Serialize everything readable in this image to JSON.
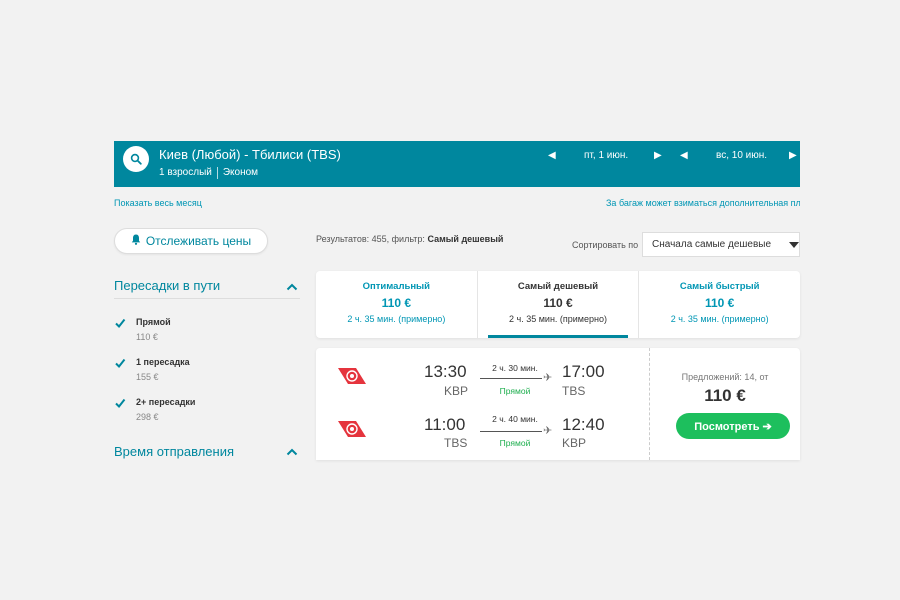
{
  "search": {
    "route": "Киев (Любой) - Тбилиси (TBS)",
    "passengers": "1 взрослый",
    "cabin": "Эконом",
    "date_depart": "пт, 1 июн.",
    "date_return": "вс, 10 июн."
  },
  "links": {
    "show_month": "Показать весь месяц",
    "baggage_note": "За багаж может взиматься дополнительная пла"
  },
  "sidebar": {
    "track_prices": "Отслеживать цены",
    "stops_title": "Пересадки в пути",
    "stops": [
      {
        "label": "Прямой",
        "price": "110 €",
        "checked": true
      },
      {
        "label": "1 пересадка",
        "price": "155 €",
        "checked": true
      },
      {
        "label": "2+ пересадки",
        "price": "298 €",
        "checked": true
      }
    ],
    "departure_title": "Время отправления"
  },
  "results": {
    "summary_prefix": "Результатов: 455, фильтр:",
    "summary_filter": "Самый дешевый",
    "sort_label": "Сортировать по",
    "sort_value": "Сначала самые дешевые"
  },
  "tabs": [
    {
      "label": "Оптимальный",
      "price": "110 €",
      "duration": "2 ч. 35 мин. (примерно)",
      "active": false
    },
    {
      "label": "Самый дешевый",
      "price": "110 €",
      "duration": "2 ч. 35 мин. (примерно)",
      "active": true
    },
    {
      "label": "Самый быстрый",
      "price": "110 €",
      "duration": "2 ч. 35 мин. (примерно)",
      "active": false
    }
  ],
  "ticket": {
    "legs": [
      {
        "dep_time": "13:30",
        "dep_code": "KBP",
        "duration": "2 ч. 30 мин.",
        "type": "Прямой",
        "arr_time": "17:00",
        "arr_code": "TBS"
      },
      {
        "dep_time": "11:00",
        "dep_code": "TBS",
        "duration": "2 ч. 40 мин.",
        "type": "Прямой",
        "arr_time": "12:40",
        "arr_code": "KBP"
      }
    ],
    "offers": "Предложений: 14, от",
    "price": "110 €",
    "view_button": "Посмотреть ➔"
  },
  "colors": {
    "brand": "#00879e",
    "link": "#0096b4",
    "cta": "#1dbf5d",
    "airline": "#e5343d"
  },
  "icons": [
    "search-icon",
    "chevron-left-icon",
    "chevron-right-icon",
    "bell-icon",
    "chevron-up-icon",
    "checkmark-icon",
    "caret-down-icon",
    "airline-logo-icon",
    "plane-icon"
  ]
}
